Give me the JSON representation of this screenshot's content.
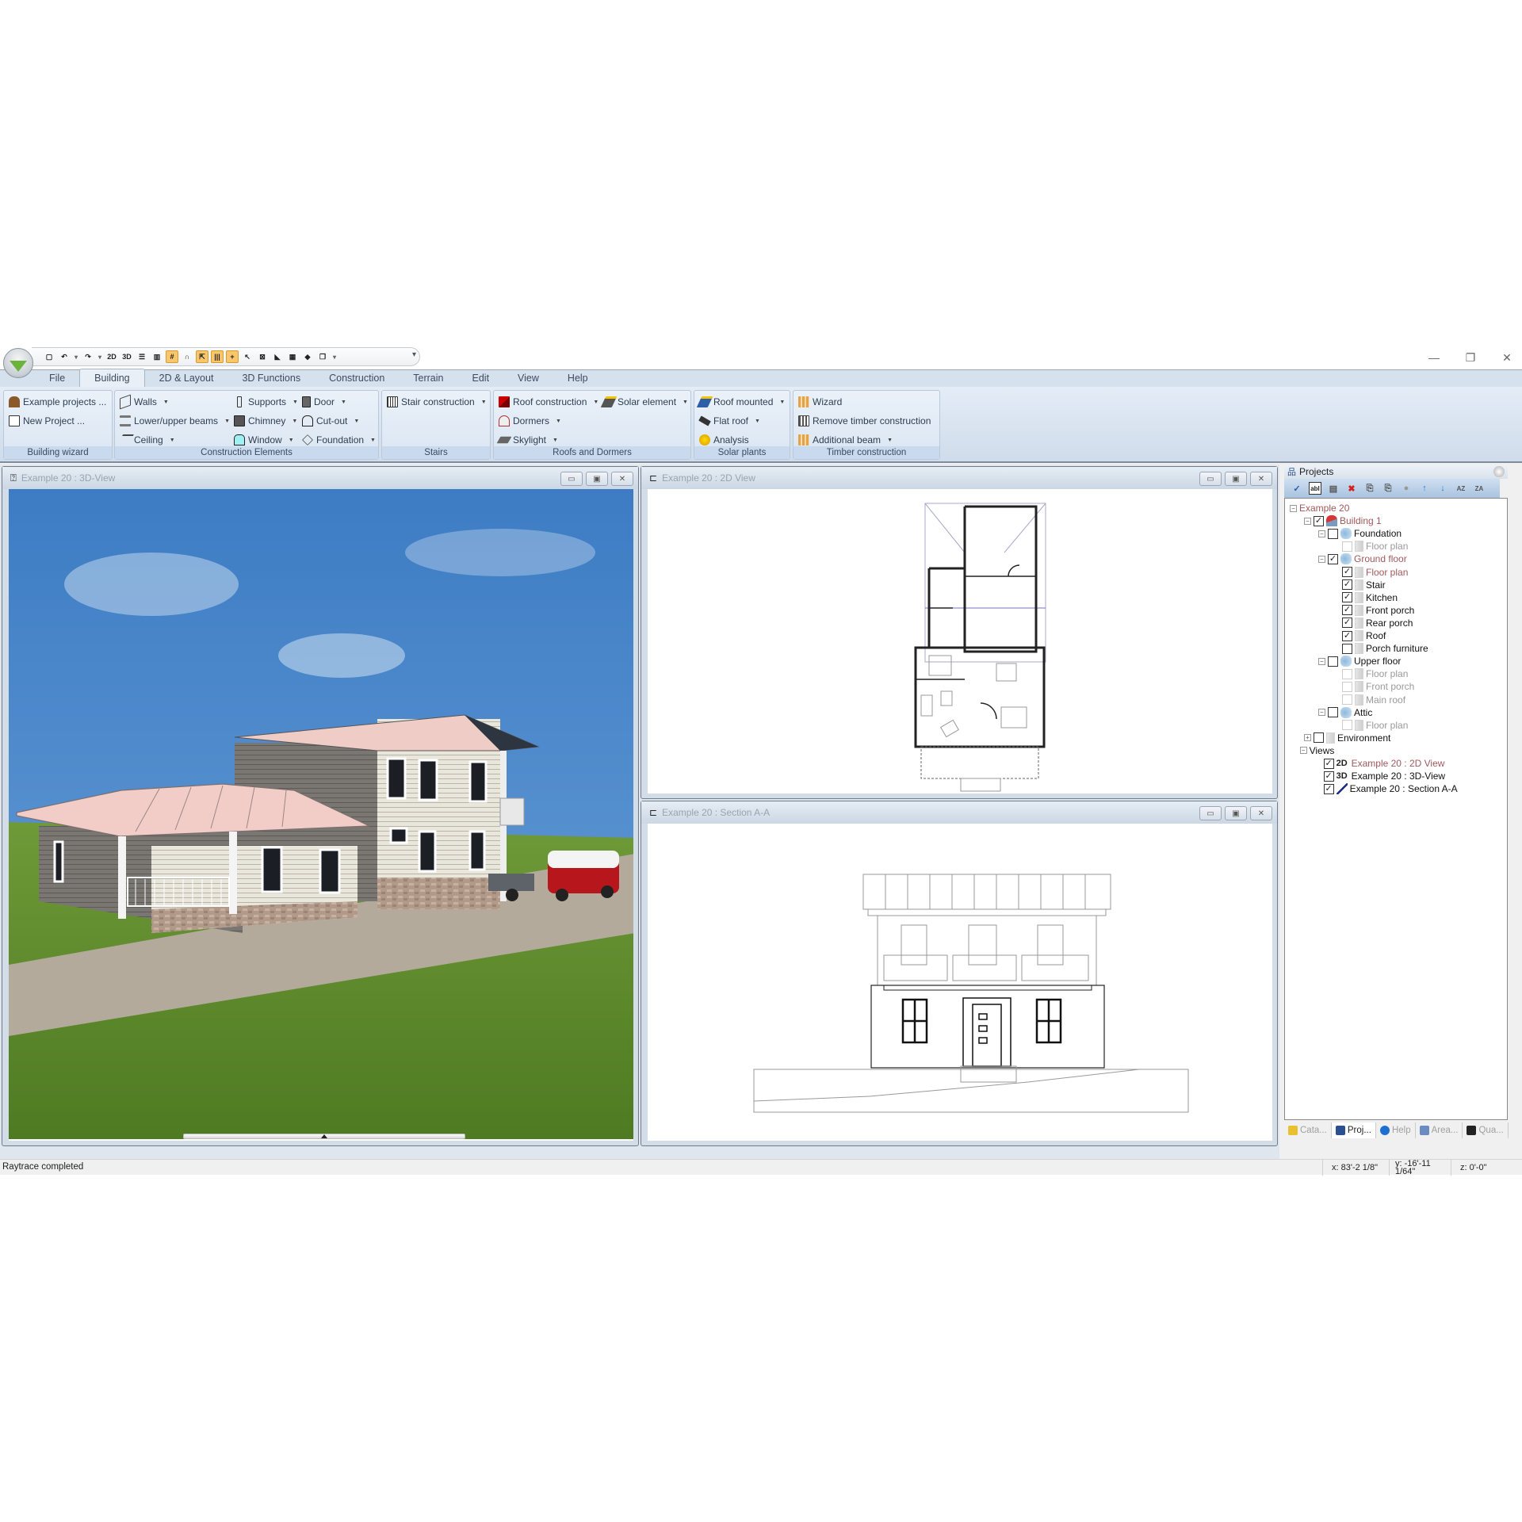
{
  "window": {
    "controls": {
      "minimize": "—",
      "restore": "❐",
      "close": "✕"
    }
  },
  "quick_access": [
    {
      "icon": "new-document-icon",
      "glyph": "▢"
    },
    {
      "icon": "undo-icon",
      "glyph": "↶"
    },
    {
      "icon": "redo-icon",
      "glyph": "↷"
    },
    {
      "icon": "view-2d-icon",
      "glyph": "2D"
    },
    {
      "icon": "view-3d-icon",
      "glyph": "3D"
    },
    {
      "icon": "split-horizontal-icon",
      "glyph": "☰"
    },
    {
      "icon": "split-vertical-icon",
      "glyph": "▥"
    },
    {
      "icon": "grid-icon",
      "glyph": "#",
      "active": true
    },
    {
      "icon": "magnet-icon",
      "glyph": "∩"
    },
    {
      "icon": "snap-select-icon",
      "glyph": "⇱",
      "active": true
    },
    {
      "icon": "parallel-lines-icon",
      "glyph": "|||",
      "active": true
    },
    {
      "icon": "crosshair-icon",
      "glyph": "+",
      "active": true
    },
    {
      "icon": "pointer-icon",
      "glyph": "↖"
    },
    {
      "icon": "object-box-icon",
      "glyph": "⊠"
    },
    {
      "icon": "roof-red-icon",
      "glyph": "◣"
    },
    {
      "icon": "timber-icon",
      "glyph": "▦"
    },
    {
      "icon": "solar-panel-icon",
      "glyph": "◆"
    },
    {
      "icon": "copy-windows-icon",
      "glyph": "❐"
    }
  ],
  "menu_tabs": [
    {
      "label": "File"
    },
    {
      "label": "Building",
      "active": true
    },
    {
      "label": "2D & Layout"
    },
    {
      "label": "3D Functions"
    },
    {
      "label": "Construction"
    },
    {
      "label": "Terrain"
    },
    {
      "label": "Edit"
    },
    {
      "label": "View"
    },
    {
      "label": "Help"
    }
  ],
  "ribbon": {
    "groups": [
      {
        "label": "Building wizard",
        "items": [
          {
            "label": "Example projects ...",
            "icon": "house-icon",
            "dropdown": false
          },
          {
            "label": "New Project ...",
            "icon": "new-project-icon",
            "dropdown": false
          }
        ]
      },
      {
        "label": "Construction Elements",
        "items": [
          {
            "label": "Walls",
            "icon": "walls-icon",
            "dropdown": true
          },
          {
            "label": "Lower/upper beams",
            "icon": "beams-icon",
            "dropdown": true
          },
          {
            "label": "Ceiling",
            "icon": "ceiling-icon",
            "dropdown": true
          },
          {
            "label": "Supports",
            "icon": "supports-icon",
            "dropdown": true
          },
          {
            "label": "Chimney",
            "icon": "chimney-icon",
            "dropdown": true
          },
          {
            "label": "Window",
            "icon": "window-icon",
            "dropdown": true
          },
          {
            "label": "Door",
            "icon": "door-icon",
            "dropdown": true
          },
          {
            "label": "Cut-out",
            "icon": "cutout-icon",
            "dropdown": true
          },
          {
            "label": "Foundation",
            "icon": "foundation-icon",
            "dropdown": true
          }
        ]
      },
      {
        "label": "Stairs",
        "items": [
          {
            "label": "Stair construction",
            "icon": "stair-icon",
            "dropdown": true
          }
        ]
      },
      {
        "label": "Roofs and Dormers",
        "items": [
          {
            "label": "Roof construction",
            "icon": "roof-icon",
            "dropdown": true
          },
          {
            "label": "Dormers",
            "icon": "dormer-icon",
            "dropdown": true
          },
          {
            "label": "Skylight",
            "icon": "skylight-icon",
            "dropdown": true
          },
          {
            "label": "Solar element",
            "icon": "solar-element-icon",
            "dropdown": true
          }
        ]
      },
      {
        "label": "Solar plants",
        "items": [
          {
            "label": "Roof mounted",
            "icon": "roof-mounted-icon",
            "dropdown": true
          },
          {
            "label": "Flat roof",
            "icon": "flat-roof-icon",
            "dropdown": true
          },
          {
            "label": "Analysis",
            "icon": "analysis-icon",
            "dropdown": false
          }
        ]
      },
      {
        "label": "Timber construction",
        "items": [
          {
            "label": "Wizard",
            "icon": "timber-wizard-icon",
            "dropdown": false
          },
          {
            "label": "Remove timber construction",
            "icon": "remove-timber-icon",
            "dropdown": false
          },
          {
            "label": "Additional beam",
            "icon": "additional-beam-icon",
            "dropdown": true
          }
        ]
      }
    ]
  },
  "views": {
    "view3d": {
      "title": "Example 20 : 3D-View"
    },
    "view2d": {
      "title": "Example 20 : 2D View"
    },
    "section": {
      "title": "Example 20 : Section A-A"
    },
    "child_buttons": {
      "minimize": "▭",
      "maximize": "▣",
      "close": "✕"
    }
  },
  "projects_panel": {
    "title": "Projects",
    "toolbar": [
      {
        "icon": "check-icon",
        "glyph": "✓"
      },
      {
        "icon": "rename-icon",
        "glyph": "abl"
      },
      {
        "icon": "properties-icon",
        "glyph": "▤"
      },
      {
        "icon": "delete-icon",
        "glyph": "✖"
      },
      {
        "icon": "copy-icon",
        "glyph": "⎘"
      },
      {
        "icon": "paste-icon",
        "glyph": "⎘"
      },
      {
        "icon": "sphere-icon",
        "glyph": "●"
      },
      {
        "icon": "move-up-icon",
        "glyph": "↑"
      },
      {
        "icon": "move-down-icon",
        "glyph": "↓"
      },
      {
        "icon": "sort-az-icon",
        "glyph": "AZ"
      },
      {
        "icon": "sort-za-icon",
        "glyph": "ZA"
      }
    ],
    "tree": [
      {
        "label": "Example 20",
        "level": 0,
        "expander": "−",
        "checkbox": null,
        "icon": null,
        "style": "red"
      },
      {
        "label": "Building 1",
        "level": 1,
        "expander": "−",
        "checkbox": true,
        "icon": "building",
        "style": "red"
      },
      {
        "label": "Foundation",
        "level": 2,
        "expander": "−",
        "checkbox": false,
        "icon": "level",
        "style": "normal"
      },
      {
        "label": "Floor plan",
        "level": 3,
        "expander": null,
        "checkbox": false,
        "icon": "doc",
        "style": "gray",
        "disabled": true
      },
      {
        "label": "Ground floor",
        "level": 2,
        "expander": "−",
        "checkbox": true,
        "icon": "level",
        "style": "red"
      },
      {
        "label": "Floor plan",
        "level": 3,
        "expander": null,
        "checkbox": true,
        "icon": "doc",
        "style": "red"
      },
      {
        "label": "Stair",
        "level": 3,
        "expander": null,
        "checkbox": true,
        "icon": "doc",
        "style": "normal"
      },
      {
        "label": "Kitchen",
        "level": 3,
        "expander": null,
        "checkbox": true,
        "icon": "doc",
        "style": "normal"
      },
      {
        "label": "Front porch",
        "level": 3,
        "expander": null,
        "checkbox": true,
        "icon": "doc",
        "style": "normal"
      },
      {
        "label": "Rear porch",
        "level": 3,
        "expander": null,
        "checkbox": true,
        "icon": "doc",
        "style": "normal"
      },
      {
        "label": "Roof",
        "level": 3,
        "expander": null,
        "checkbox": true,
        "icon": "doc",
        "style": "normal"
      },
      {
        "label": "Porch furniture",
        "level": 3,
        "expander": null,
        "checkbox": false,
        "icon": "doc",
        "style": "normal"
      },
      {
        "label": "Upper floor",
        "level": 2,
        "expander": "−",
        "checkbox": false,
        "icon": "level",
        "style": "normal"
      },
      {
        "label": "Floor plan",
        "level": 3,
        "expander": null,
        "checkbox": false,
        "icon": "doc",
        "style": "gray",
        "disabled": true
      },
      {
        "label": "Front porch",
        "level": 3,
        "expander": null,
        "checkbox": false,
        "icon": "doc",
        "style": "gray",
        "disabled": true
      },
      {
        "label": "Main roof",
        "level": 3,
        "expander": null,
        "checkbox": false,
        "icon": "doc",
        "style": "gray",
        "disabled": true
      },
      {
        "label": "Attic",
        "level": 2,
        "expander": "−",
        "checkbox": false,
        "icon": "level",
        "style": "normal"
      },
      {
        "label": "Floor plan",
        "level": 3,
        "expander": null,
        "checkbox": false,
        "icon": "doc",
        "style": "gray",
        "disabled": true
      },
      {
        "label": "Environment",
        "level": 1,
        "expander": "+",
        "checkbox": false,
        "icon": "doc",
        "style": "normal"
      },
      {
        "label": "Views",
        "level": 0.7,
        "expander": "−",
        "checkbox": null,
        "icon": null,
        "style": "normal"
      },
      {
        "label": "Example 20 : 2D View",
        "level": 1.7,
        "expander": null,
        "checkbox": true,
        "icon": "tag-2d",
        "tag": "2D",
        "style": "red"
      },
      {
        "label": "Example 20 : 3D-View",
        "level": 1.7,
        "expander": null,
        "checkbox": true,
        "icon": "tag-3d",
        "tag": "3D",
        "style": "normal"
      },
      {
        "label": "Example 20 : Section A-A",
        "level": 1.7,
        "expander": null,
        "checkbox": true,
        "icon": "section",
        "style": "normal"
      }
    ],
    "bottom_tabs": [
      {
        "label": "Cata...",
        "icon": "catalog-icon",
        "active": false
      },
      {
        "label": "Proj...",
        "icon": "projects-icon",
        "active": true
      },
      {
        "label": "Help",
        "icon": "help-icon",
        "active": false
      },
      {
        "label": "Area...",
        "icon": "area-icon",
        "active": false
      },
      {
        "label": "Qua...",
        "icon": "quantity-icon",
        "active": false
      }
    ]
  },
  "status_bar": {
    "message": "Raytrace completed",
    "x": "x: 83'-2 1/8\"",
    "y_line1": "y: -16'-11",
    "y_line2": "1/64\"",
    "z": "z: 0'-0\""
  },
  "colors": {
    "ribbon_bg": "#dbe6f2",
    "active_qat": "#f8c66b",
    "tree_red": "#a0595c",
    "sky": "#4a86c8",
    "grass": "#5f8a2c",
    "roof": "#f2c9c4"
  }
}
